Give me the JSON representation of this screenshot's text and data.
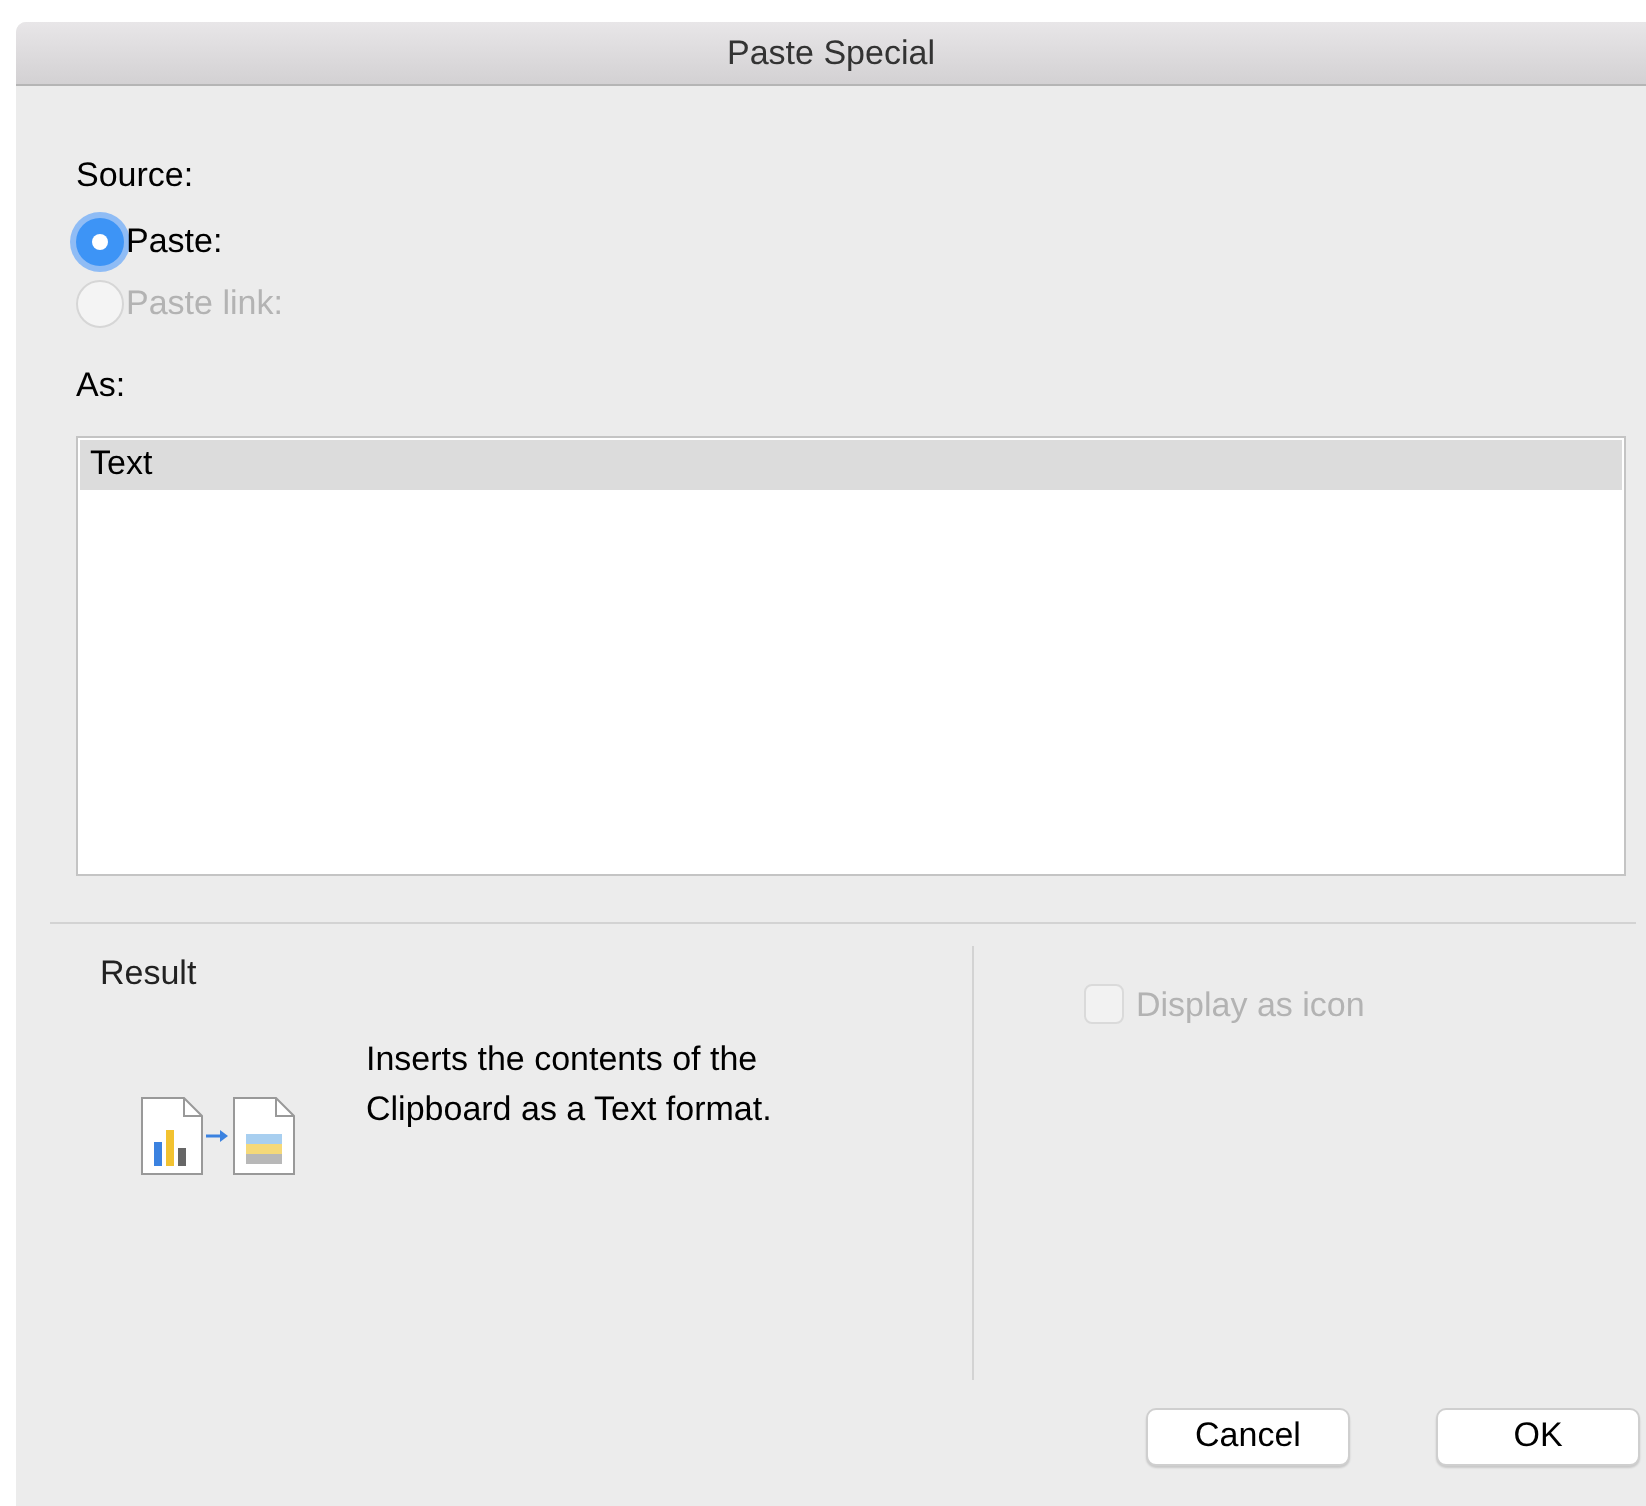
{
  "window": {
    "title": "Paste Special"
  },
  "source": {
    "label": "Source:",
    "options": [
      {
        "label": "Paste:",
        "selected": true,
        "disabled": false
      },
      {
        "label": "Paste link:",
        "selected": false,
        "disabled": true
      }
    ]
  },
  "as": {
    "label": "As:",
    "items": [
      {
        "label": "Text",
        "selected": true
      }
    ]
  },
  "result": {
    "label": "Result",
    "description": "Inserts the contents of the Clipboard as a Text format."
  },
  "display_as_icon": {
    "label": "Display as icon",
    "checked": false,
    "disabled": true
  },
  "buttons": [
    {
      "label": "Cancel"
    },
    {
      "label": "OK"
    }
  ]
}
